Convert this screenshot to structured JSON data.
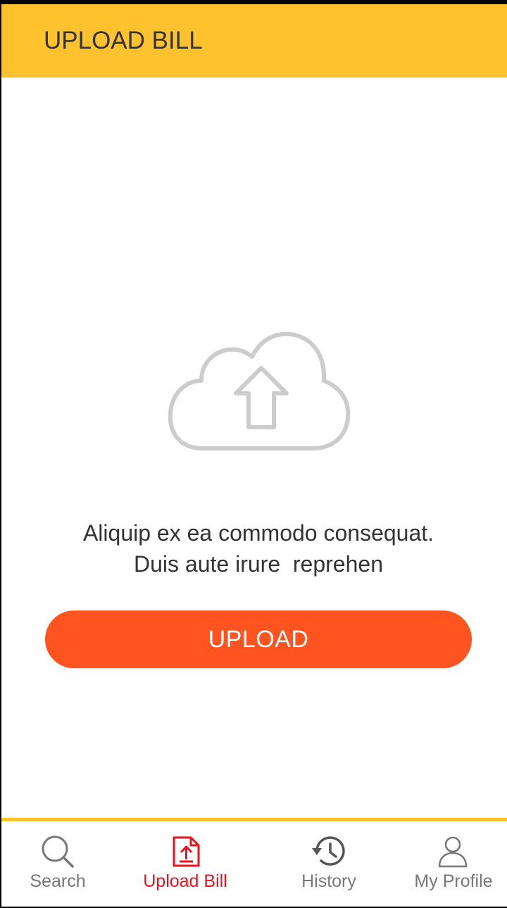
{
  "app_bar": {
    "title": "UPLOAD BILL",
    "background": "#fec22f"
  },
  "main": {
    "icon": "cloud-upload-icon",
    "message_line1": "Aliquip ex ea commodo consequat.",
    "message_line2": "Duis aute irure  reprehen",
    "upload_button_label": "UPLOAD",
    "button_color": "#ff5420"
  },
  "bottom_nav": {
    "active_tab": "Upload Bill",
    "active_color": "#e8141f",
    "items": [
      {
        "label": "Search",
        "icon": "search-icon"
      },
      {
        "label": "Upload Bill",
        "icon": "file-upload-icon"
      },
      {
        "label": "History",
        "icon": "history-icon"
      },
      {
        "label": "My Profile",
        "icon": "user-icon"
      }
    ]
  }
}
